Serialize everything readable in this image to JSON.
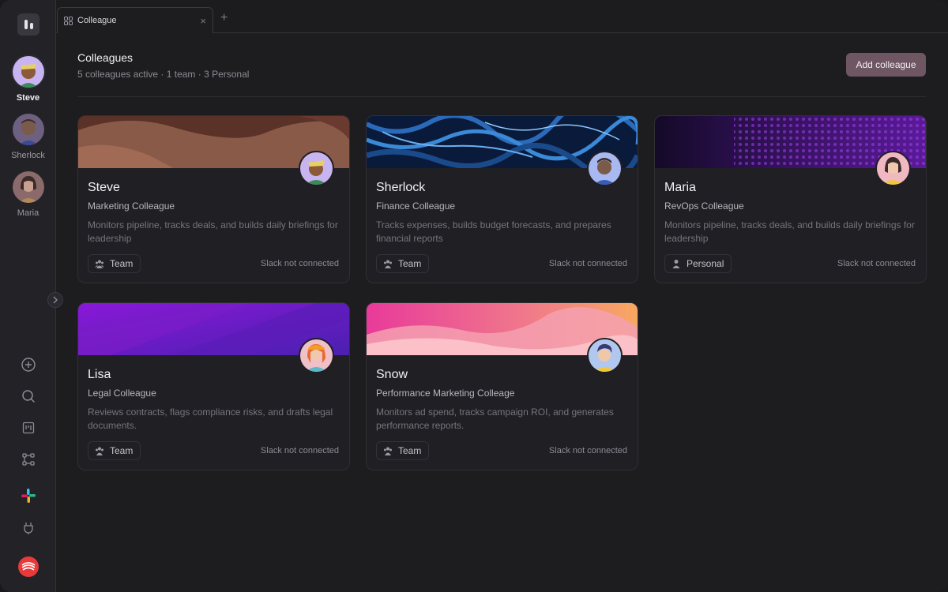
{
  "tab": {
    "label": "Colleague",
    "close": "×",
    "add": "+"
  },
  "page": {
    "title": "Colleagues",
    "subtitle": "5 colleagues active · 1 team · 3 Personal",
    "add_button": "Add colleague"
  },
  "rail": {
    "agents": [
      {
        "label": "Steve",
        "active": true
      },
      {
        "label": "Sherlock",
        "active": false
      },
      {
        "label": "Maria",
        "active": false
      }
    ],
    "icons": [
      "plus-icon",
      "search-icon",
      "board-icon",
      "workflow-icon",
      "slack-icon",
      "plug-icon",
      "brand-logo-icon"
    ]
  },
  "cards": [
    {
      "name": "Steve",
      "role": "Marketing Colleague",
      "description": "Monitors pipeline, tracks deals, and builds daily briefings for leadership",
      "badge": "Team",
      "slack": "Slack not connected"
    },
    {
      "name": "Sherlock",
      "role": "Finance Colleague",
      "description": "Tracks expenses, builds budget forecasts, and prepares financial reports",
      "badge": "Team",
      "slack": "Slack not connected"
    },
    {
      "name": "Maria",
      "role": "RevOps Colleague",
      "description": "Monitors pipeline, tracks deals, and builds daily briefings for leadership",
      "badge": "Personal",
      "slack": "Slack not connected"
    },
    {
      "name": "Lisa",
      "role": "Legal Colleague",
      "description": "Reviews contracts, flags compliance risks, and drafts legal documents.",
      "badge": "Team",
      "slack": "Slack not connected"
    },
    {
      "name": "Snow",
      "role": "Performance Marketing Colleage",
      "description": "Monitors ad spend, tracks campaign ROI, and generates performance reports.",
      "badge": "Team",
      "slack": "Slack not connected"
    }
  ],
  "colors": {
    "accent_button": "#6e5662",
    "background": "#1d1c1f",
    "card": "#201f23"
  }
}
